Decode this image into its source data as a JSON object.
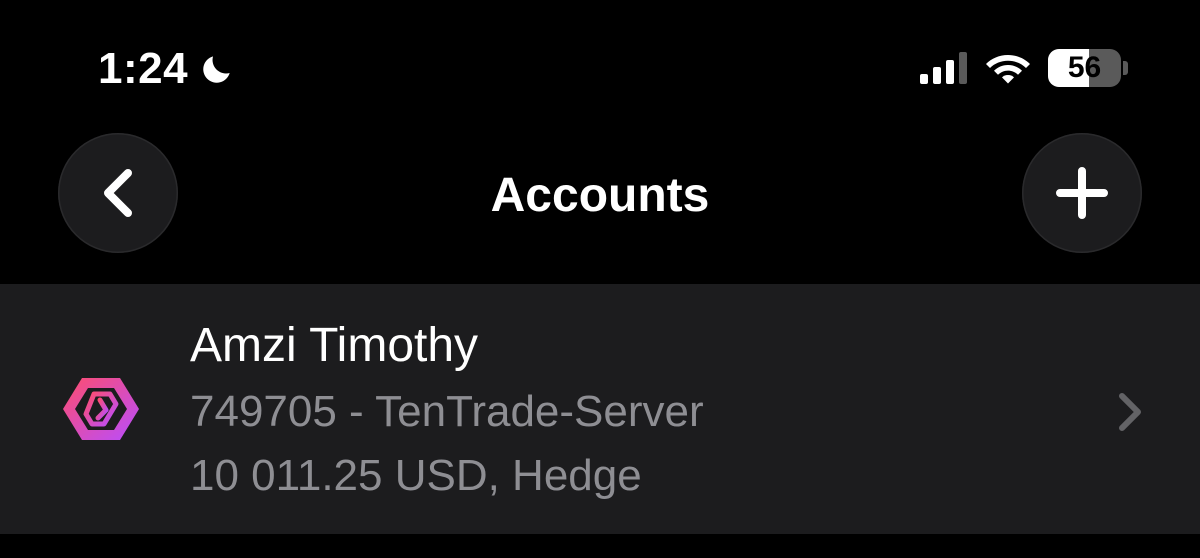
{
  "status_bar": {
    "time": "1:24",
    "battery_level": "56",
    "battery_fraction": 0.56,
    "icons": [
      "moon-icon",
      "cellular-signal-icon",
      "wifi-icon",
      "battery-icon"
    ]
  },
  "nav": {
    "title": "Accounts",
    "back_icon": "chevron-left-icon",
    "add_icon": "plus-icon"
  },
  "accounts": [
    {
      "name": "Amzi Timothy",
      "server_line": "749705 - TenTrade-Server",
      "balance_line": "10 011.25 USD, Hedge",
      "logo_icon": "broker-logo-icon",
      "chevron_icon": "chevron-right-icon"
    }
  ],
  "colors": {
    "background": "#000000",
    "row_background": "#1c1c1e",
    "primary_text": "#ffffff",
    "secondary_text": "#8e8e93",
    "logo_gradient_start": "#ff4d6d",
    "logo_gradient_end": "#b84dff"
  }
}
